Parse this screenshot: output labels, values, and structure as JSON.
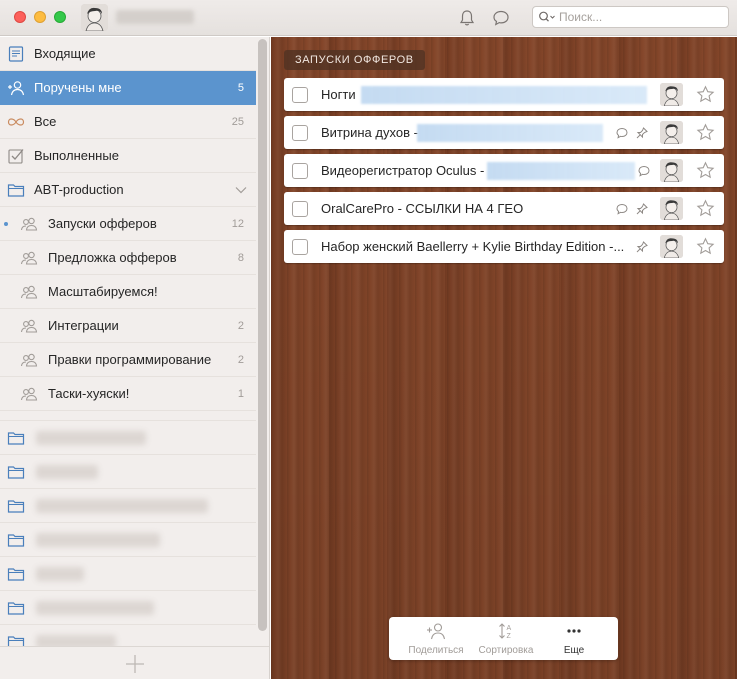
{
  "titlebar": {
    "search_placeholder": "Поиск..."
  },
  "sidebar": {
    "items": [
      {
        "label": "Входящие",
        "count": ""
      },
      {
        "label": "Поручены мне",
        "count": "5"
      },
      {
        "label": "Все",
        "count": "25"
      },
      {
        "label": "Выполненные",
        "count": ""
      },
      {
        "label": "ABT-production",
        "count": ""
      },
      {
        "label": "Запуски офферов",
        "count": "12"
      },
      {
        "label": "Предложка офферов",
        "count": "8"
      },
      {
        "label": "Масштабируемся!",
        "count": ""
      },
      {
        "label": "Интеграции",
        "count": "2"
      },
      {
        "label": "Правки программирование",
        "count": "2"
      },
      {
        "label": "Таски-хуяски!",
        "count": "1"
      }
    ]
  },
  "main": {
    "list_title": "ЗАПУСКИ ОФФЕРОВ",
    "tasks": [
      {
        "title": "Ногти"
      },
      {
        "title": "Витрина духов -"
      },
      {
        "title": "Видеорегистратор Oculus -"
      },
      {
        "title": "OralCarePro - ССЫЛКИ НА 4 ГЕО"
      },
      {
        "title": "Набор женский Baellerry + Kylie Birthday Edition -..."
      }
    ]
  },
  "toolbar": {
    "share_label": "Поделиться",
    "sort_label": "Сортировка",
    "more_label": "Еще"
  },
  "colors": {
    "accent": "#5b94ce",
    "wood": "#8b4a2c"
  }
}
